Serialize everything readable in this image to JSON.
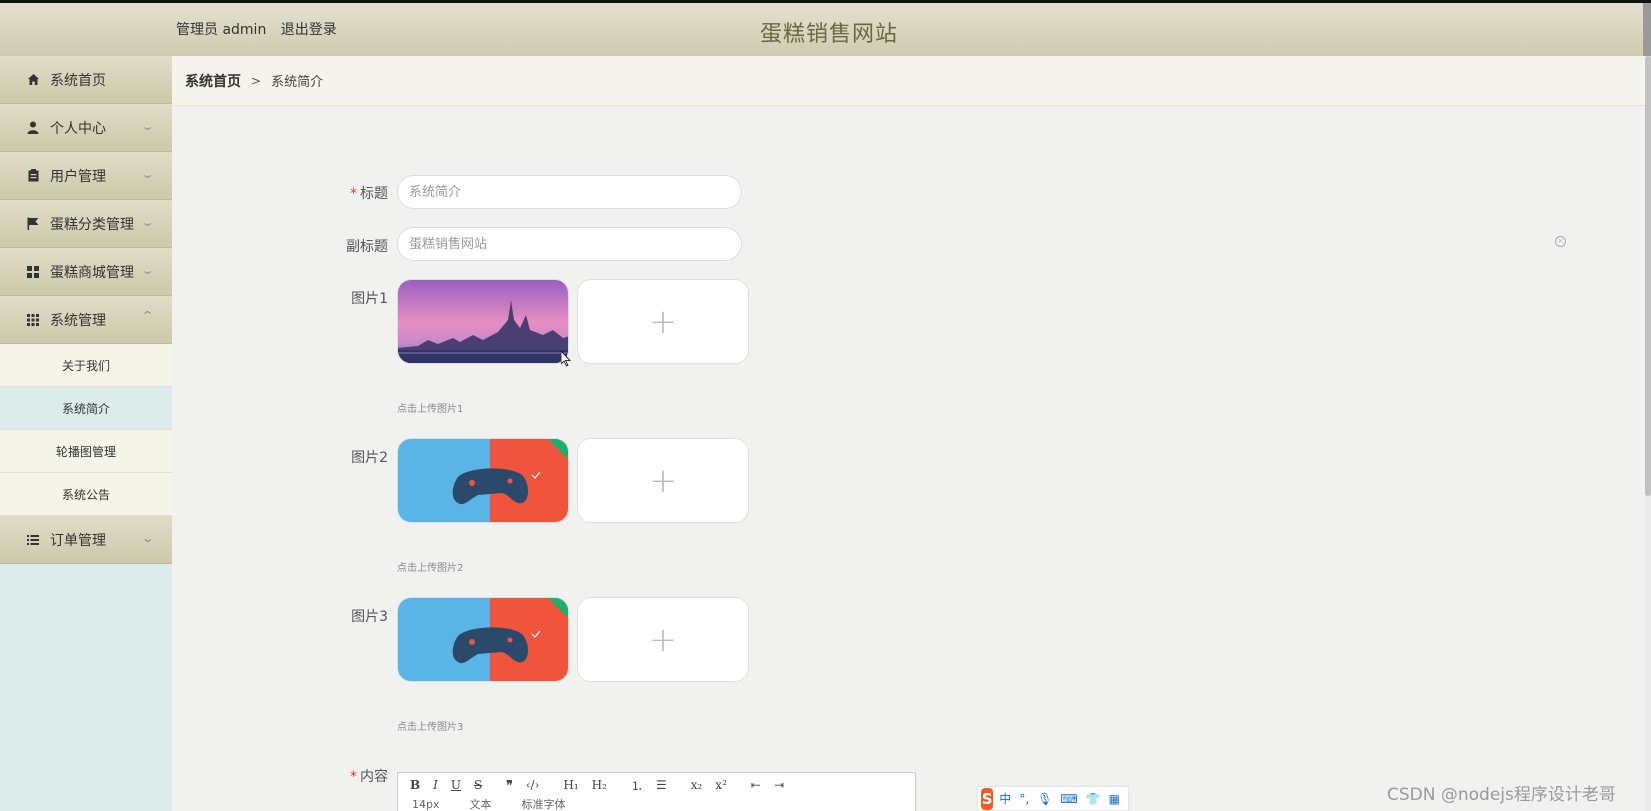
{
  "header": {
    "user_label": "管理员 admin",
    "logout_label": "退出登录",
    "site_title": "蛋糕销售网站"
  },
  "sidebar": {
    "items": [
      {
        "label": "系统首页",
        "icon": "home-icon",
        "expandable": false
      },
      {
        "label": "个人中心",
        "icon": "user-icon",
        "expandable": true
      },
      {
        "label": "用户管理",
        "icon": "clipboard-icon",
        "expandable": true
      },
      {
        "label": "蛋糕分类管理",
        "icon": "flag-icon",
        "expandable": true
      },
      {
        "label": "蛋糕商城管理",
        "icon": "grid-icon",
        "expandable": true
      },
      {
        "label": "系统管理",
        "icon": "apps-icon",
        "expandable": true,
        "expanded": true
      },
      {
        "label": "订单管理",
        "icon": "list-icon",
        "expandable": true
      }
    ],
    "system_sub_items": [
      {
        "label": "关于我们",
        "active": false
      },
      {
        "label": "系统简介",
        "active": true
      },
      {
        "label": "轮播图管理",
        "active": false
      },
      {
        "label": "系统公告",
        "active": false
      }
    ]
  },
  "breadcrumb": {
    "home": "系统首页",
    "separator": ">",
    "current": "系统简介"
  },
  "form": {
    "title_label": "标题",
    "title_placeholder": "系统简介",
    "subtitle_label": "副标题",
    "subtitle_placeholder": "蛋糕销售网站",
    "image1_label": "图片1",
    "image1_hint": "点击上传图片1",
    "image2_label": "图片2",
    "image2_hint": "点击上传图片2",
    "image3_label": "图片3",
    "image3_hint": "点击上传图片3",
    "content_label": "内容",
    "required_mark": "*",
    "upload_plus": "+"
  },
  "editor": {
    "toolbar_row2": [
      "14px",
      "文本",
      "标准字体"
    ]
  },
  "ime": {
    "logo": "S",
    "mode": "中"
  },
  "watermark": "CSDN @nodejs程序设计老哥",
  "colors": {
    "header_bg": "#d6d2b8",
    "sidebar_bg": "#dbecea",
    "title_color": "#6b6740",
    "required": "#e4393c"
  }
}
